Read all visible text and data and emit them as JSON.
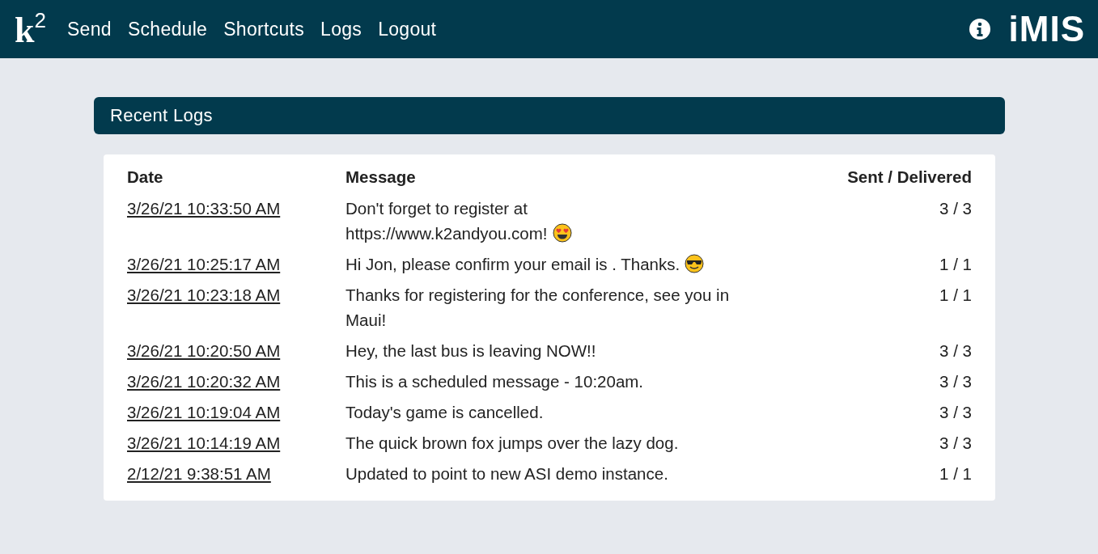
{
  "nav": {
    "logo": "k$^{2}$",
    "items": [
      "Send",
      "Schedule",
      "Shortcuts",
      "Logs",
      "Logout"
    ],
    "brand": "iMIS"
  },
  "panel": {
    "title": "Recent Logs"
  },
  "table": {
    "columns": [
      "Date",
      "Message",
      "Sent / Delivered"
    ],
    "rows": [
      {
        "date": "3/26/21 10:33:50 AM",
        "message": "Don't forget to register at https://www.k2andyou.com!",
        "kind": "hearteyes",
        "count": "3 / 3"
      },
      {
        "date": "3/26/21 10:25:17 AM",
        "message": "Hi Jon, please confirm your email is . Thanks.",
        "kind": "sunglasses",
        "count": "1 / 1"
      },
      {
        "date": "3/26/21 10:23:18 AM",
        "message": "Thanks for registering for the conference, see you in Maui!",
        "count": "1 / 1"
      },
      {
        "date": "3/26/21 10:20:50 AM",
        "message": "Hey, the last bus is leaving NOW!!",
        "count": "3 / 3"
      },
      {
        "date": "3/26/21 10:20:32 AM",
        "message": "This is a scheduled message - 10:20am.",
        "count": "3 / 3"
      },
      {
        "date": "3/26/21 10:19:04 AM",
        "message": "Today's game is cancelled.",
        "count": "3 / 3"
      },
      {
        "date": "3/26/21 10:14:19 AM",
        "message": "The quick brown fox jumps over the lazy dog.",
        "count": "3 / 3"
      },
      {
        "date": "2/12/21 9:38:51 AM",
        "message": "Updated to point to new ASI demo instance.",
        "count": "1 / 1"
      }
    ]
  }
}
